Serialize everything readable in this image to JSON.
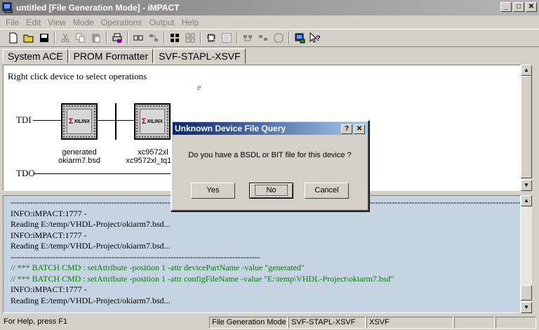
{
  "window": {
    "title": "untitled [File Generation Mode] - iMPACT"
  },
  "window_buttons": [
    "_",
    "□",
    "✕"
  ],
  "menu": [
    "File",
    "Edit",
    "View",
    "Mode",
    "Operations",
    "Output",
    "Help"
  ],
  "toolbar_icons": [
    "new-file-icon",
    "open-folder-icon",
    "save-disk-icon",
    "cut-icon",
    "copy-icon",
    "paste-icon",
    "print-icon",
    "program-icon",
    "verify-icon",
    "chip-select-icon",
    "chip-grid-icon",
    "chain-icon",
    "config-icon",
    "erase-icon",
    "blank-check-icon",
    "readback-icon",
    "color-chip-icon",
    "context-help-icon"
  ],
  "tabs": [
    "System ACE",
    "PROM Formatter",
    "SVF-STAPL-XSVF"
  ],
  "active_tab": 2,
  "canvas": {
    "hint": "Right click device to select operations",
    "stray": "e",
    "tdi": "TDI",
    "tdo": "TDO",
    "devices": [
      {
        "brand": "XILINX",
        "line1": "generated",
        "line2": "okiarm7.bsd"
      },
      {
        "brand": "XILINX",
        "line1": "xc9572xl",
        "line2": "xc9572xl_tq100"
      }
    ]
  },
  "log": [
    {
      "text": "------------------------------------------------------------------------------------------------------------------------------------------------------------------------------------------------------------",
      "color": "black"
    },
    {
      "text": "INFO:iMPACT:1777 -",
      "color": "black"
    },
    {
      "text": "Reading E:/temp/VHDL-Project/okiarm7.bsd...",
      "color": "black"
    },
    {
      "text": "INFO:iMPACT:1777 -",
      "color": "black"
    },
    {
      "text": "Reading E:/temp/VHDL-Project/okiarm7.bsd...",
      "color": "black"
    },
    {
      "text": "-----------------------------------------------------------------------------------------",
      "color": "black"
    },
    {
      "text": "// *** BATCH CMD : setAttribute -position 1 -attr devicePartName -value \"generated\"",
      "color": "green"
    },
    {
      "text": "// *** BATCH CMD : setAttribute -position 1 -attr configFileName -value \"E:\\temp\\VHDL-Project\\okiarm7.bsd\"",
      "color": "green"
    },
    {
      "text": "INFO:iMPACT:1777 -",
      "color": "black"
    },
    {
      "text": "Reading E:/temp/VHDL-Project/okiarm7.bsd...",
      "color": "black"
    }
  ],
  "status": {
    "help": "For Help, press F1",
    "mode": "File Generation Mode",
    "tab": "SVF-STAPL-XSVF",
    "format": "XSVF"
  },
  "dialog": {
    "title": "Unknown Device File Query",
    "help_btn": "?",
    "close_btn": "✕",
    "message": "Do you have a BSDL or BIT file for this device ?",
    "yes": "Yes",
    "no": "No",
    "cancel": "Cancel"
  },
  "colors": {
    "title_inactive": "#808080",
    "dialog_title": "#0a246a",
    "log_bg": "#c6d3e3",
    "log_green": "#008000"
  }
}
